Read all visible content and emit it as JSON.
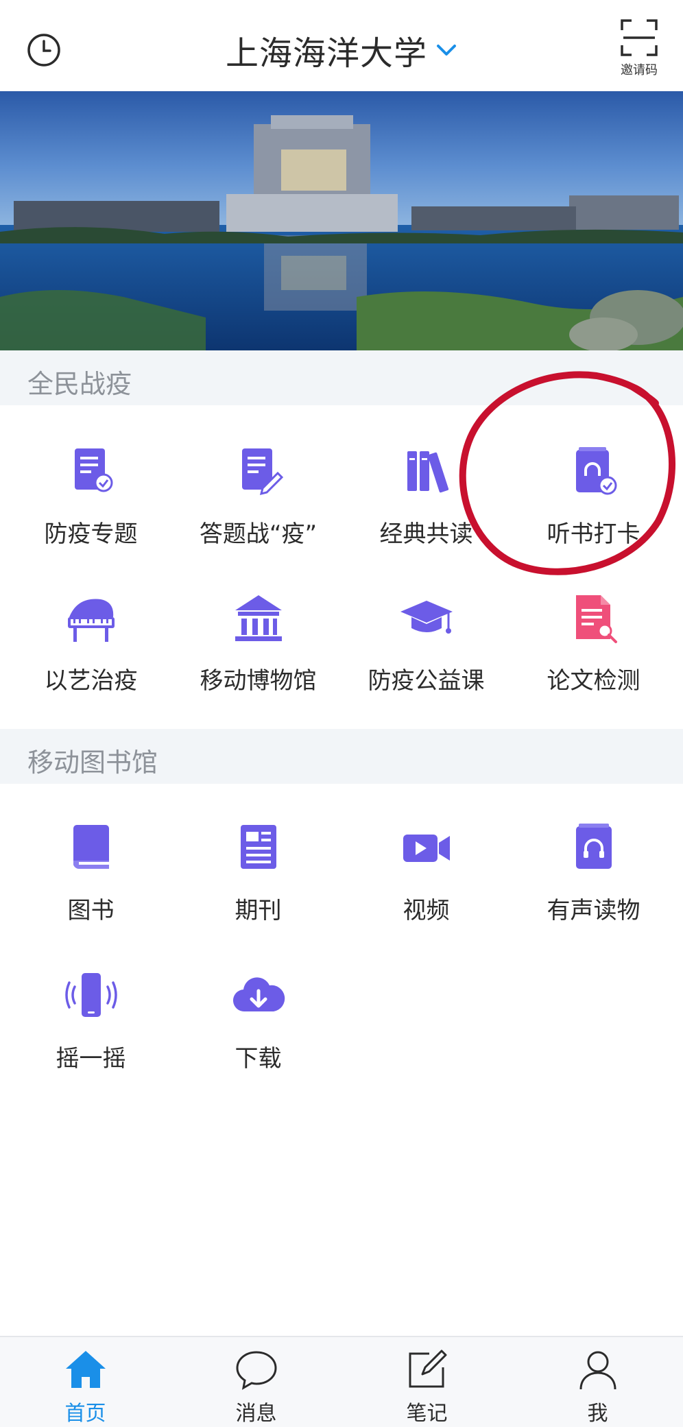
{
  "header": {
    "school_name": "上海海洋大学",
    "invite_label": "邀请码"
  },
  "sections": {
    "epidemic": {
      "title": "全民战疫",
      "items": [
        {
          "label": "防疫专题",
          "icon": "document-medal-icon"
        },
        {
          "label": "答题战“疫”",
          "icon": "document-pen-icon"
        },
        {
          "label": "经典共读",
          "icon": "books-icon"
        },
        {
          "label": "听书打卡",
          "icon": "audiobook-check-icon"
        },
        {
          "label": "以艺治疫",
          "icon": "piano-icon"
        },
        {
          "label": "移动博物馆",
          "icon": "museum-icon"
        },
        {
          "label": "防疫公益课",
          "icon": "graduation-cap-icon"
        },
        {
          "label": "论文检测",
          "icon": "paper-search-icon"
        }
      ]
    },
    "library": {
      "title": "移动图书馆",
      "items": [
        {
          "label": "图书",
          "icon": "book-icon"
        },
        {
          "label": "期刊",
          "icon": "journal-icon"
        },
        {
          "label": "视频",
          "icon": "video-camera-icon"
        },
        {
          "label": "有声读物",
          "icon": "audiobook-icon"
        },
        {
          "label": "摇一摇",
          "icon": "shake-phone-icon"
        },
        {
          "label": "下载",
          "icon": "cloud-download-icon"
        }
      ]
    }
  },
  "tabbar": {
    "tabs": [
      {
        "label": "首页",
        "icon": "home-icon",
        "active": true
      },
      {
        "label": "消息",
        "icon": "chat-bubble-icon",
        "active": false
      },
      {
        "label": "笔记",
        "icon": "note-edit-icon",
        "active": false
      },
      {
        "label": "我",
        "icon": "user-icon",
        "active": false
      }
    ]
  },
  "colors": {
    "icon_purple": "#6c5ce7",
    "icon_pink": "#ef4f7a",
    "accent_blue": "#1a8fe8",
    "section_band": "#f2f5f8",
    "annotation_red": "#c8102e"
  }
}
